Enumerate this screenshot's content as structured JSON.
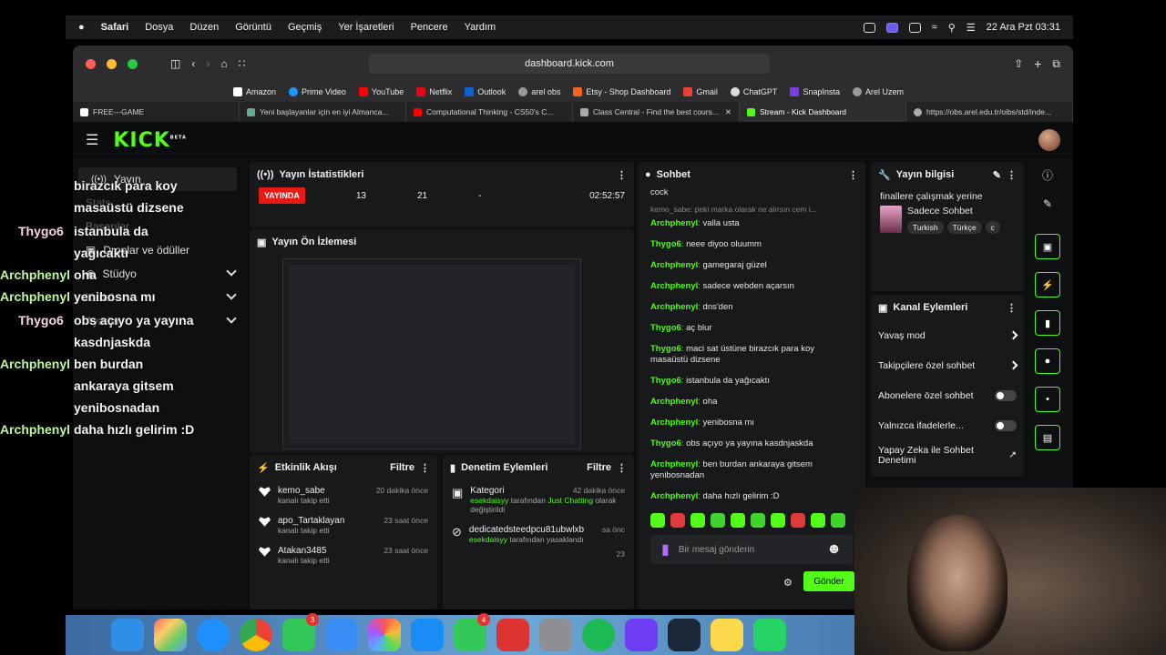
{
  "menubar": {
    "app": "Safari",
    "items": [
      "Dosya",
      "Düzen",
      "Görüntü",
      "Geçmiş",
      "Yer İşaretleri",
      "Pencere",
      "Yardım"
    ],
    "clock": "22 Ara Pzt 03:31"
  },
  "browser": {
    "url": "dashboard.kick.com",
    "favorites": [
      "Amazon",
      "Prime Video",
      "YouTube",
      "Netflix",
      "Outlook",
      "arel obs",
      "Etsy - Shop Dashboard",
      "Gmail",
      "ChatGPT",
      "SnapInsta",
      "Arel Uzem"
    ],
    "tabs": [
      "FREE---GAME",
      "Yeni başlayanlar için en iyi Almanca...",
      "Computational Thinking - CS50's C...",
      "Class Central - Find the best cours...",
      "Stream - Kick Dashboard",
      "https://obs.arel.edu.tr/oibs/std/inde..."
    ],
    "active_tab_index": 4
  },
  "kick": {
    "logo": "KICK",
    "logo_badge": "BETA",
    "sidebar": [
      {
        "label": "Yayın",
        "selected": true
      },
      {
        "label": "Stats"
      },
      {
        "label": "Başarılar"
      },
      {
        "label": "Droplar ve ödüller"
      },
      {
        "label": "Stüdyo"
      },
      {
        "label": "Kanal"
      },
      {
        "label": "Ayarlar"
      }
    ],
    "stats": {
      "title": "Yayın İstatistikleri",
      "live": "YAYINDA",
      "viewers": "13",
      "followers": "21",
      "subs": "-",
      "duration": "02:52:57"
    },
    "preview": {
      "title": "Yayın Ön İzlemesi"
    },
    "activity": {
      "title": "Etkinlik Akışı",
      "filter": "Filtre",
      "items": [
        {
          "user": "kemo_sabe",
          "sub": "kanalı takip etti",
          "time": "20 dakika önce"
        },
        {
          "user": "apo_Tartaklayan",
          "sub": "kanalı takip etti",
          "time": "23 saat önce"
        },
        {
          "user": "Atakan3485",
          "sub": "kanalı takip etti",
          "time": "23 saat önce"
        }
      ]
    },
    "moderation": {
      "title": "Denetim Eylemleri",
      "filter": "Filtre",
      "items": [
        {
          "title": "Kategori",
          "time": "42 dakika önce",
          "actor": "esekdaisyy",
          "mid": "tarafından",
          "target": "Just Chatting",
          "tail": "olarak değiştirildi"
        },
        {
          "title": "dedicatedsteedpcu81ubwlxb",
          "time": "sa önc",
          "actor": "esekdaisyy",
          "mid": "tarafından yasaklandı"
        }
      ],
      "more": "23"
    },
    "chat": {
      "title": "Sohbet",
      "top": "cock",
      "reply": "kemo_sabe: peki marka olarak ne alırsın cem i...",
      "messages": [
        {
          "u": "Archphenyl",
          "t": "valla usta"
        },
        {
          "u": "Thygo6",
          "t": "neee diyoo oluumm"
        },
        {
          "u": "Archphenyl",
          "t": "gamegaraj güzel"
        },
        {
          "u": "Archphenyl",
          "t": "sadece webden açarsın"
        },
        {
          "u": "Archphenyl",
          "t": "dns'den"
        },
        {
          "u": "Thygo6",
          "t": "aç blur"
        },
        {
          "u": "Thygo6",
          "t": "maci sat üstüne birazcık para koy masaüstü dizsene"
        },
        {
          "u": "Thygo6",
          "t": "istanbula da yağıcaktı"
        },
        {
          "u": "Archphenyl",
          "t": "oha"
        },
        {
          "u": "Archphenyl",
          "t": "yenibosna mı"
        },
        {
          "u": "Thygo6",
          "t": "obs açıyo ya yayına kasdnjaskda"
        },
        {
          "u": "Archphenyl",
          "t": "ben burdan ankaraya gitsem yenibosnadan"
        },
        {
          "u": "Archphenyl",
          "t": "daha hızlı gelirim :D"
        }
      ],
      "placeholder": "Bir mesaj gönderin",
      "send": "Gönder"
    },
    "info": {
      "title": "Yayın bilgisi",
      "stream_title": "finallere çalışmak yerine",
      "category": "Sadece Sohbet",
      "tags": [
        "Turkish",
        "Türkçe",
        "c"
      ]
    },
    "actions": {
      "title": "Kanal Eylemleri",
      "items": [
        {
          "label": "Yavaş mod",
          "kind": "arrow"
        },
        {
          "label": "Takipçilere özel sohbet",
          "kind": "arrow"
        },
        {
          "label": "Abonelere özel sohbet",
          "kind": "toggle"
        },
        {
          "label": "Yalnızca ifadelerle...",
          "kind": "toggle"
        },
        {
          "label": "Yapay Zeka ile Sohbet Denetimi",
          "kind": "ext"
        }
      ]
    }
  },
  "overlay": [
    {
      "name": "",
      "text": "birazcık para koy"
    },
    {
      "name": "",
      "text": "masaüstü dizsene"
    },
    {
      "name": "Thygo6",
      "text": "istanbula da"
    },
    {
      "name": "",
      "text": "yağıcaktı"
    },
    {
      "name": "Archphenyl",
      "text": "oha"
    },
    {
      "name": "Archphenyl",
      "text": "yenibosna mı"
    },
    {
      "name": "Thygo6",
      "text": "obs açıyo ya yayına"
    },
    {
      "name": "",
      "text": "kasdnjaskda"
    },
    {
      "name": "Archphenyl",
      "text": "ben burdan"
    },
    {
      "name": "",
      "text": "ankaraya gitsem"
    },
    {
      "name": "",
      "text": "yenibosnadan"
    },
    {
      "name": "Archphenyl",
      "text": "daha hızlı gelirim :D"
    }
  ],
  "dock_badges": {
    "messages": "3",
    "facetime": "4"
  }
}
